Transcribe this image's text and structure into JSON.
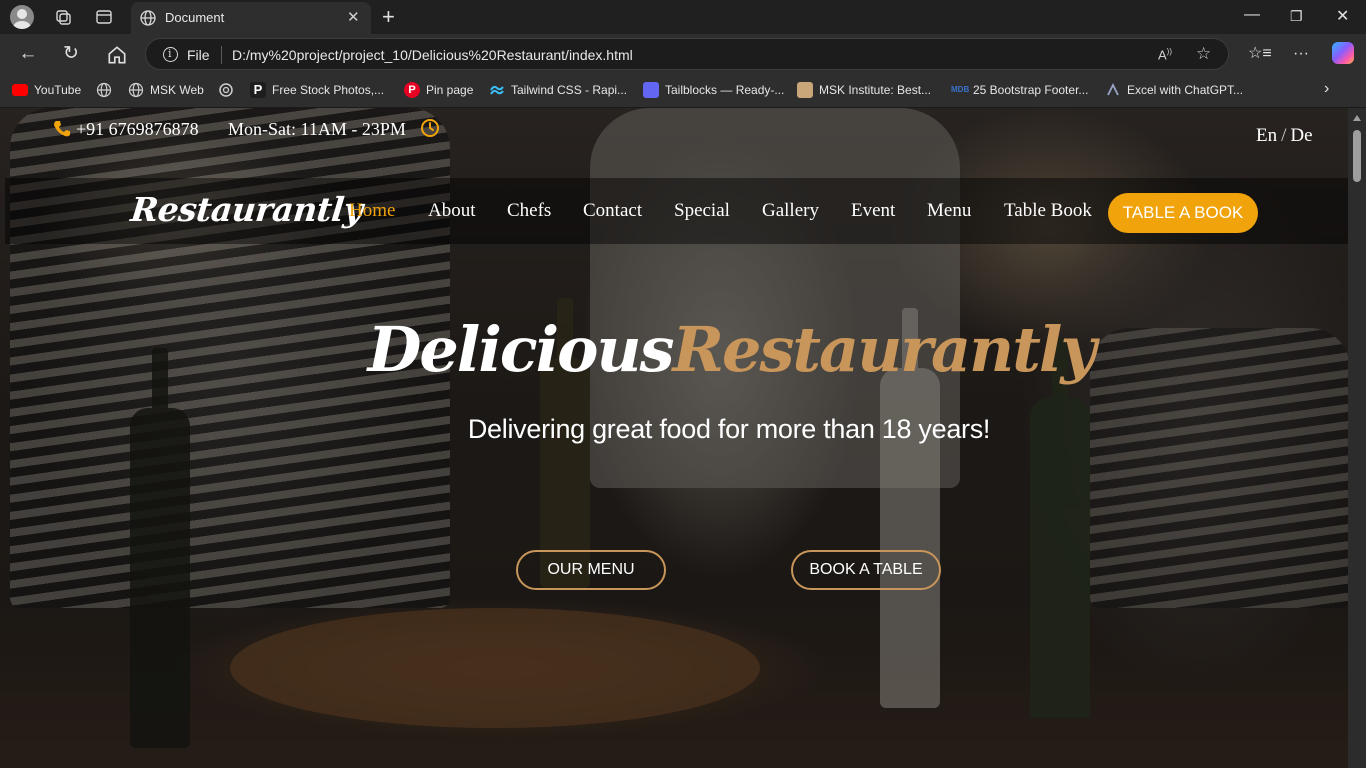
{
  "browser": {
    "tab_title": "Document",
    "file_label": "File",
    "url": "D:/my%20project/project_10/Delicious%20Restaurant/index.html",
    "bookmarks": [
      {
        "label": "YouTube",
        "icon": "youtube-icon",
        "color": "#ff0000"
      },
      {
        "label": "",
        "icon": "globe-icon",
        "color": "#cfcfcf"
      },
      {
        "label": "MSK Web",
        "icon": "globe-icon",
        "color": "#cfcfcf"
      },
      {
        "label": "",
        "icon": "openai-icon",
        "color": "#cfcfcf"
      },
      {
        "label": "Free Stock Photos,...",
        "icon": "pexels-icon",
        "color": "#ffffff"
      },
      {
        "label": "Pin page",
        "icon": "pinterest-icon",
        "color": "#e60023"
      },
      {
        "label": "Tailwind CSS - Rapi...",
        "icon": "tailwind-icon",
        "color": "#38bdf8"
      },
      {
        "label": "Tailblocks — Ready-...",
        "icon": "tailblocks-icon",
        "color": "#6366f1"
      },
      {
        "label": "MSK Institute: Best...",
        "icon": "msk-icon",
        "color": "#c9a67a"
      },
      {
        "label": "25 Bootstrap Footer...",
        "icon": "mdb-icon",
        "color": "#3b71ca"
      },
      {
        "label": "Excel with ChatGPT...",
        "icon": "excel-icon",
        "color": "#9aa6c8"
      }
    ]
  },
  "site": {
    "phone": "+91 6769876878",
    "hours": "Mon-Sat: 11AM - 23PM",
    "lang_en": "En",
    "lang_sep": "/",
    "lang_de": "De",
    "logo": "Restaurantly",
    "nav": [
      "Home",
      "About",
      "Chefs",
      "Contact",
      "Special",
      "Gallery",
      "Event",
      "Menu",
      "Table Book"
    ],
    "cta": "TABLE A BOOK",
    "hero_title_white": "Delicious",
    "hero_title_gold": "Restaurantly",
    "hero_sub": "Delivering great food for more than 18 years!",
    "btn_menu": "OUR MENU",
    "btn_book": "BOOK A TABLE"
  },
  "colors": {
    "accent": "#f0a30a",
    "gold": "#c8955a"
  }
}
